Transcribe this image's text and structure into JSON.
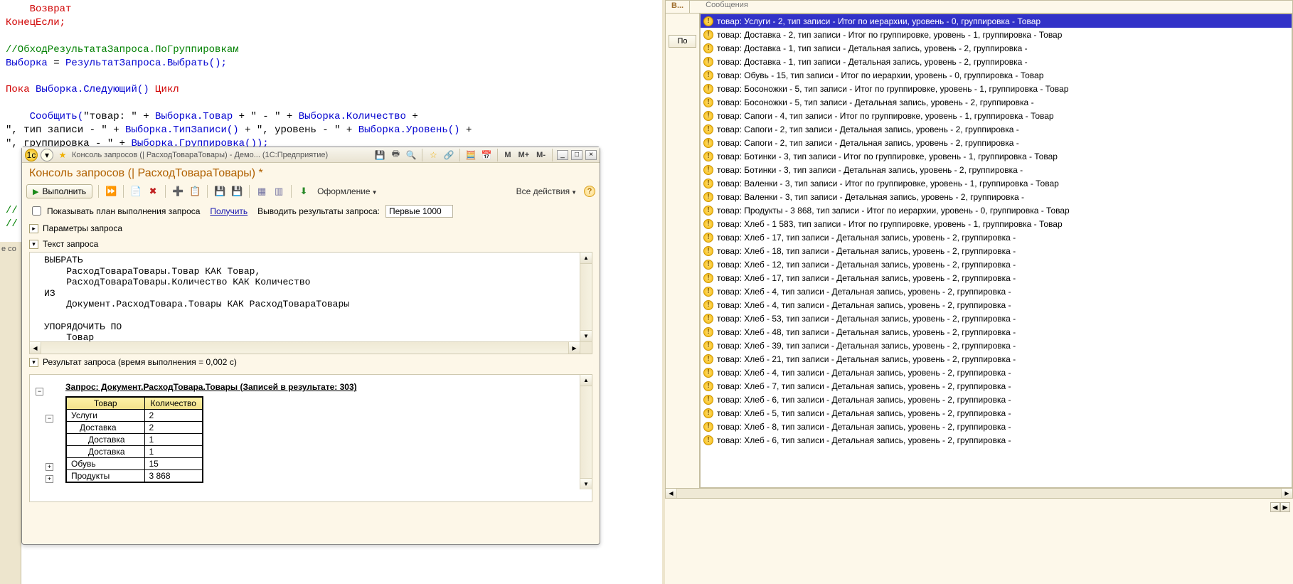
{
  "code": {
    "l1a": "    Возврат",
    "l2": "КонецЕсли;",
    "l3_cmt": "//ОбходРезультатаЗапроса.ПоГруппировкам",
    "l4a": "Выборка ",
    "l4b": "= ",
    "l4c": "РезультатЗапроса.Выбрать();",
    "l5a": "Пока ",
    "l5b": "Выборка.Следующий() ",
    "l5c": "Цикл",
    "l6a": "    Сообщить(",
    "l6b": "\"товар: \" ",
    "l6c": "+ ",
    "l6d": "Выборка.Товар ",
    "l6e": "+ ",
    "l6f": "\" - \" ",
    "l6g": "+ ",
    "l6h": "Выборка.Количество ",
    "l6i": "+",
    "l7a": "\", тип записи - \" ",
    "l7b": "+ ",
    "l7c": "Выборка.ТипЗаписи() ",
    "l7d": "+ ",
    "l7e": "\", уровень - \" ",
    "l7f": "+ ",
    "l7g": "Выборка.Уровень() ",
    "l7h": "+",
    "l8a": "\", группировка - \" ",
    "l8b": "+ ",
    "l8c": "Выборка.Группировка());",
    "l9": "// ",
    "l10": "// "
  },
  "qc": {
    "titlebar": "Консоль запросов (| РасходТовараТовары) - Демо...   (1С:Предприятие)",
    "header": "Консоль запросов (| РасходТовараТовары) *",
    "run": "Выполнить",
    "decoration": "Оформление",
    "all_actions": "Все действия",
    "show_plan": "Показывать план выполнения запроса",
    "get_link": "Получить",
    "output_label": "Выводить результаты запроса:",
    "output_value": "Первые 1000",
    "params_section": "Параметры запроса",
    "text_section": "Текст запроса",
    "query_text": "ВЫБРАТЬ\n    РасходТовараТовары.Товар КАК Товар,\n    РасходТовараТовары.Количество КАК Количество\nИЗ\n    Документ.РасходТовара.Товары КАК РасходТовараТовары\n\nУПОРЯДОЧИТЬ ПО\n    Товар",
    "result_section": "Результат запроса (время выполнения = 0,002 с)",
    "result_title": "Запрос: Документ.РасходТовара.Товары (Записей в результате: 303)",
    "headers": {
      "товар": "Товар",
      "кол": "Количество"
    },
    "rows": [
      {
        "lvl": 0,
        "t": "Услуги",
        "q": "2"
      },
      {
        "lvl": 1,
        "t": "Доставка",
        "q": "2"
      },
      {
        "lvl": 2,
        "t": "Доставка",
        "q": "1"
      },
      {
        "lvl": 2,
        "t": "Доставка",
        "q": "1"
      },
      {
        "lvl": 0,
        "t": "Обувь",
        "q": "15"
      },
      {
        "lvl": 0,
        "t": "Продукты",
        "q": "3 868"
      }
    ],
    "m": "M",
    "mp": "M+",
    "mm": "M-"
  },
  "rp": {
    "tab1": "В...",
    "tab2": "Сообщения",
    "po": "По",
    "messages": [
      "товар: Услуги - 2, тип записи - Итог по иерархии, уровень - 0, группировка - Товар",
      "товар: Доставка - 2, тип записи - Итог по группировке, уровень - 1, группировка - Товар",
      "товар: Доставка - 1, тип записи - Детальная запись, уровень - 2, группировка -",
      "товар: Доставка - 1, тип записи - Детальная запись, уровень - 2, группировка -",
      "товар: Обувь - 15, тип записи - Итог по иерархии, уровень - 0, группировка - Товар",
      "товар: Босоножки - 5, тип записи - Итог по группировке, уровень - 1, группировка - Товар",
      "товар: Босоножки - 5, тип записи - Детальная запись, уровень - 2, группировка -",
      "товар: Сапоги - 4, тип записи - Итог по группировке, уровень - 1, группировка - Товар",
      "товар: Сапоги - 2, тип записи - Детальная запись, уровень - 2, группировка -",
      "товар: Сапоги - 2, тип записи - Детальная запись, уровень - 2, группировка -",
      "товар: Ботинки - 3, тип записи - Итог по группировке, уровень - 1, группировка - Товар",
      "товар: Ботинки - 3, тип записи - Детальная запись, уровень - 2, группировка -",
      "товар: Валенки - 3, тип записи - Итог по группировке, уровень - 1, группировка - Товар",
      "товар: Валенки - 3, тип записи - Детальная запись, уровень - 2, группировка -",
      "товар: Продукты - 3 868, тип записи - Итог по иерархии, уровень - 0, группировка - Товар",
      "товар: Хлеб - 1 583, тип записи - Итог по группировке, уровень - 1, группировка - Товар",
      "товар: Хлеб - 17, тип записи - Детальная запись, уровень - 2, группировка -",
      "товар: Хлеб - 18, тип записи - Детальная запись, уровень - 2, группировка -",
      "товар: Хлеб - 12, тип записи - Детальная запись, уровень - 2, группировка -",
      "товар: Хлеб - 17, тип записи - Детальная запись, уровень - 2, группировка -",
      "товар: Хлеб - 4, тип записи - Детальная запись, уровень - 2, группировка -",
      "товар: Хлеб - 4, тип записи - Детальная запись, уровень - 2, группировка -",
      "товар: Хлеб - 53, тип записи - Детальная запись, уровень - 2, группировка -",
      "товар: Хлеб - 48, тип записи - Детальная запись, уровень - 2, группировка -",
      "товар: Хлеб - 39, тип записи - Детальная запись, уровень - 2, группировка -",
      "товар: Хлеб - 21, тип записи - Детальная запись, уровень - 2, группировка -",
      "товар: Хлеб - 4, тип записи - Детальная запись, уровень - 2, группировка -",
      "товар: Хлеб - 7, тип записи - Детальная запись, уровень - 2, группировка -",
      "товар: Хлеб - 6, тип записи - Детальная запись, уровень - 2, группировка -",
      "товар: Хлеб - 5, тип записи - Детальная запись, уровень - 2, группировка -",
      "товар: Хлеб - 8, тип записи - Детальная запись, уровень - 2, группировка -",
      "товар: Хлеб - 6, тип записи - Детальная запись, уровень - 2, группировка -"
    ]
  },
  "edge": {
    "label": "е со"
  }
}
